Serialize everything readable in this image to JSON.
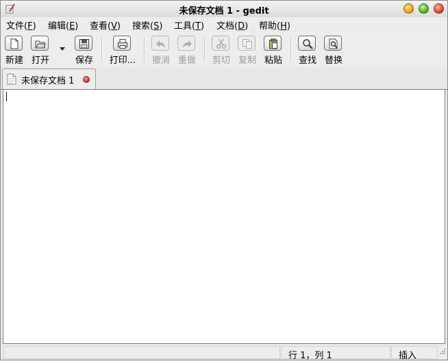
{
  "window": {
    "title": "未保存文档 1 - gedit"
  },
  "menubar": [
    {
      "label": "文件(",
      "accel": "F",
      "suffix": ")"
    },
    {
      "label": "编辑(",
      "accel": "E",
      "suffix": ")"
    },
    {
      "label": "查看(",
      "accel": "V",
      "suffix": ")"
    },
    {
      "label": "搜索(",
      "accel": "S",
      "suffix": ")"
    },
    {
      "label": "工具(",
      "accel": "T",
      "suffix": ")"
    },
    {
      "label": "文档(",
      "accel": "D",
      "suffix": ")"
    },
    {
      "label": "帮助(",
      "accel": "H",
      "suffix": ")"
    }
  ],
  "toolbar": {
    "new_label": "新建",
    "open_label": "打开",
    "save_label": "保存",
    "print_label": "打印...",
    "undo_label": "撤消",
    "redo_label": "重做",
    "cut_label": "剪切",
    "copy_label": "复制",
    "paste_label": "粘贴",
    "find_label": "查找",
    "replace_label": "替换"
  },
  "tab": {
    "label": "未保存文档 1"
  },
  "editor": {
    "content": ""
  },
  "statusbar": {
    "position": "行 1，列 1",
    "mode": "插入"
  },
  "icons": {
    "app": "gedit-icon",
    "new": "new-document-icon",
    "open": "open-folder-icon",
    "save": "floppy-disk-icon",
    "print": "printer-icon",
    "undo": "undo-arrow-icon",
    "redo": "redo-arrow-icon",
    "cut": "scissors-icon",
    "copy": "copy-icon",
    "paste": "clipboard-icon",
    "find": "magnifier-icon",
    "replace": "find-replace-icon"
  }
}
